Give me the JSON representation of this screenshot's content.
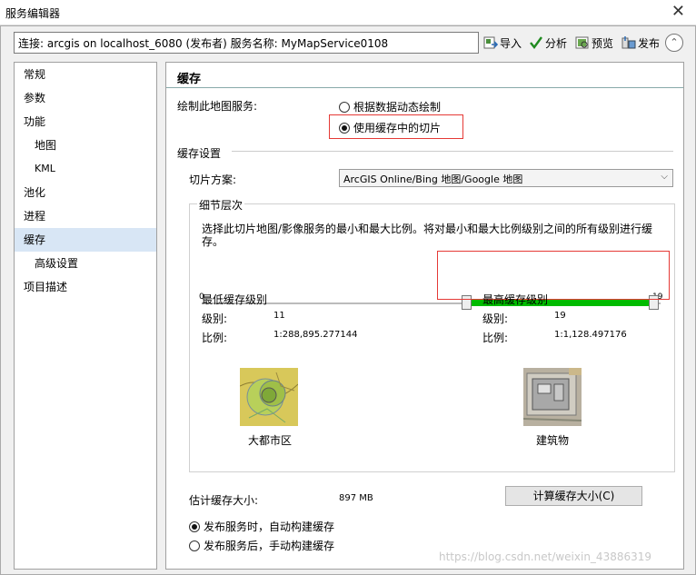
{
  "window": {
    "title": "服务编辑器",
    "close_label": "✕"
  },
  "header": {
    "connection": "连接: arcgis on localhost_6080 (发布者)    服务名称: MyMapService0108",
    "import_label": "导入",
    "analyze_label": "分析",
    "preview_label": "预览",
    "publish_label": "发布",
    "collapse_label": "⌃"
  },
  "sidebar": {
    "items": [
      {
        "label": "常规"
      },
      {
        "label": "参数"
      },
      {
        "label": "功能"
      },
      {
        "label": "地图"
      },
      {
        "label": "KML"
      },
      {
        "label": "池化"
      },
      {
        "label": "进程"
      },
      {
        "label": "缓存"
      },
      {
        "label": "高级设置"
      },
      {
        "label": "项目描述"
      }
    ]
  },
  "cache": {
    "title": "缓存",
    "draw_label": "绘制此地图服务:",
    "opt_dynamic": "根据数据动态绘制",
    "opt_tiles": "使用缓存中的切片",
    "settings_label": "缓存设置",
    "scheme_label": "切片方案:",
    "scheme_value": "ArcGIS Online/Bing 地图/Google 地图",
    "lod": {
      "title": "细节层次",
      "description_1": "选择此切片地图/影像服务的最小和最大比例。将对最小和最大比例级别之间的所有级别进行缓",
      "description_2": "存。",
      "range_min": "0",
      "range_max": "19",
      "slider_min_level": 11,
      "slider_max_level": 19,
      "min_title": "最低缓存级别",
      "max_title": "最高缓存级别",
      "level_label": "级别:",
      "scale_label": "比例:",
      "min_level": "11",
      "min_scale": "1:288,895.277144",
      "max_level": "19",
      "max_scale": "1:1,128.497176",
      "min_preview_caption": "大都市区",
      "max_preview_caption": "建筑物"
    },
    "estimate_label": "估计缓存大小:",
    "estimate_value": "897 MB",
    "calc_button": "计算缓存大小(C)",
    "build_auto": "发布服务时，自动构建缓存",
    "build_manual": "发布服务后，手动构建缓存"
  },
  "watermark": "https://blog.csdn.net/weixin_43886319"
}
